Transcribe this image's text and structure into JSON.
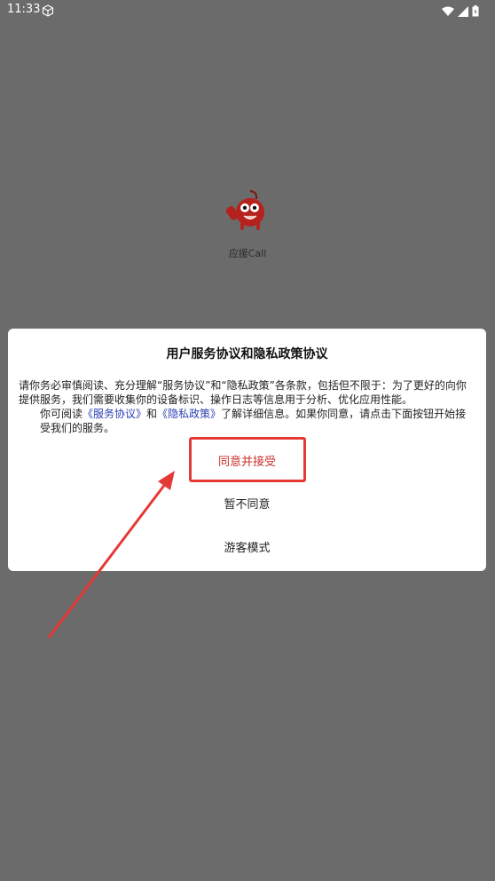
{
  "status_bar": {
    "time": "11:33",
    "icons": [
      "cube-icon",
      "wifi-icon",
      "signal-icon",
      "battery-icon"
    ]
  },
  "app": {
    "name": "应援Call",
    "logo_color": "#b5221e"
  },
  "dialog": {
    "title": "用户服务协议和隐私政策协议",
    "paragraph1": "请你务必审慎阅读、充分理解“服务协议”和“隐私政策”各条款，包括但不限于：为了更好的向你提供服务，我们需要收集你的设备标识、操作日志等信息用于分析、优化应用性能。",
    "paragraph2_before": "你可阅读",
    "link_service": "《服务协议》",
    "paragraph2_and": "和",
    "link_privacy": "《隐私政策》",
    "paragraph2_after": "了解详细信息。如果你同意，请点击下面按钮开始接受我们的服务。",
    "agree_button": "同意并接受",
    "decline_button": "暂不同意",
    "guest_button": "游客模式"
  },
  "colors": {
    "overlay": "#6b6b6b",
    "agree_text": "#c8322a",
    "highlight": "#e53935",
    "link": "#2b3fb3"
  }
}
